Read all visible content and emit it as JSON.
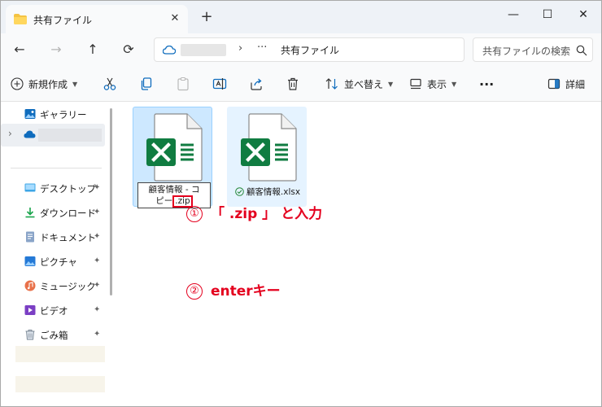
{
  "titlebar": {
    "tab_label": "共有ファイル",
    "close_glyph": "✕",
    "new_tab_glyph": "+",
    "minimize_glyph": "—",
    "maximize_glyph": "☐",
    "close_window_glyph": "✕"
  },
  "address": {
    "back_glyph": "←",
    "forward_glyph": "→",
    "up_glyph": "↑",
    "refresh_glyph": "⟳",
    "separator": "›",
    "more_glyph": "···",
    "crumb": "共有ファイル",
    "search_placeholder": "共有ファイルの検索"
  },
  "commands": {
    "new_label": "新規作成",
    "sort_label": "並べ替え",
    "view_label": "表示",
    "more_glyph": "···",
    "details_label": "詳細"
  },
  "sidebar": {
    "gallery": "ギャラリー",
    "items": [
      {
        "label": "デスクトップ",
        "icon": "desktop-icon"
      },
      {
        "label": "ダウンロード",
        "icon": "download-icon"
      },
      {
        "label": "ドキュメント",
        "icon": "documents-icon"
      },
      {
        "label": "ピクチャ",
        "icon": "pictures-icon"
      },
      {
        "label": "ミュージック",
        "icon": "music-icon"
      },
      {
        "label": "ビデオ",
        "icon": "videos-icon"
      },
      {
        "label": "ごみ箱",
        "icon": "recycle-bin-icon"
      }
    ],
    "pin_glyph": "📌"
  },
  "files": {
    "rename_line1": "顧客情報 - コ",
    "rename_line2_prefix": "ピー",
    "rename_ext": ".zip",
    "file2_name": "顧客情報.xlsx"
  },
  "annotations": {
    "step1_num": "①",
    "step1_text": "「 .zip 」 と入力",
    "step2_num": "②",
    "step2_text": "enterキー"
  },
  "colors": {
    "accent": "#e4001e",
    "excel_green": "#107c41",
    "selection": "#cde8ff"
  }
}
